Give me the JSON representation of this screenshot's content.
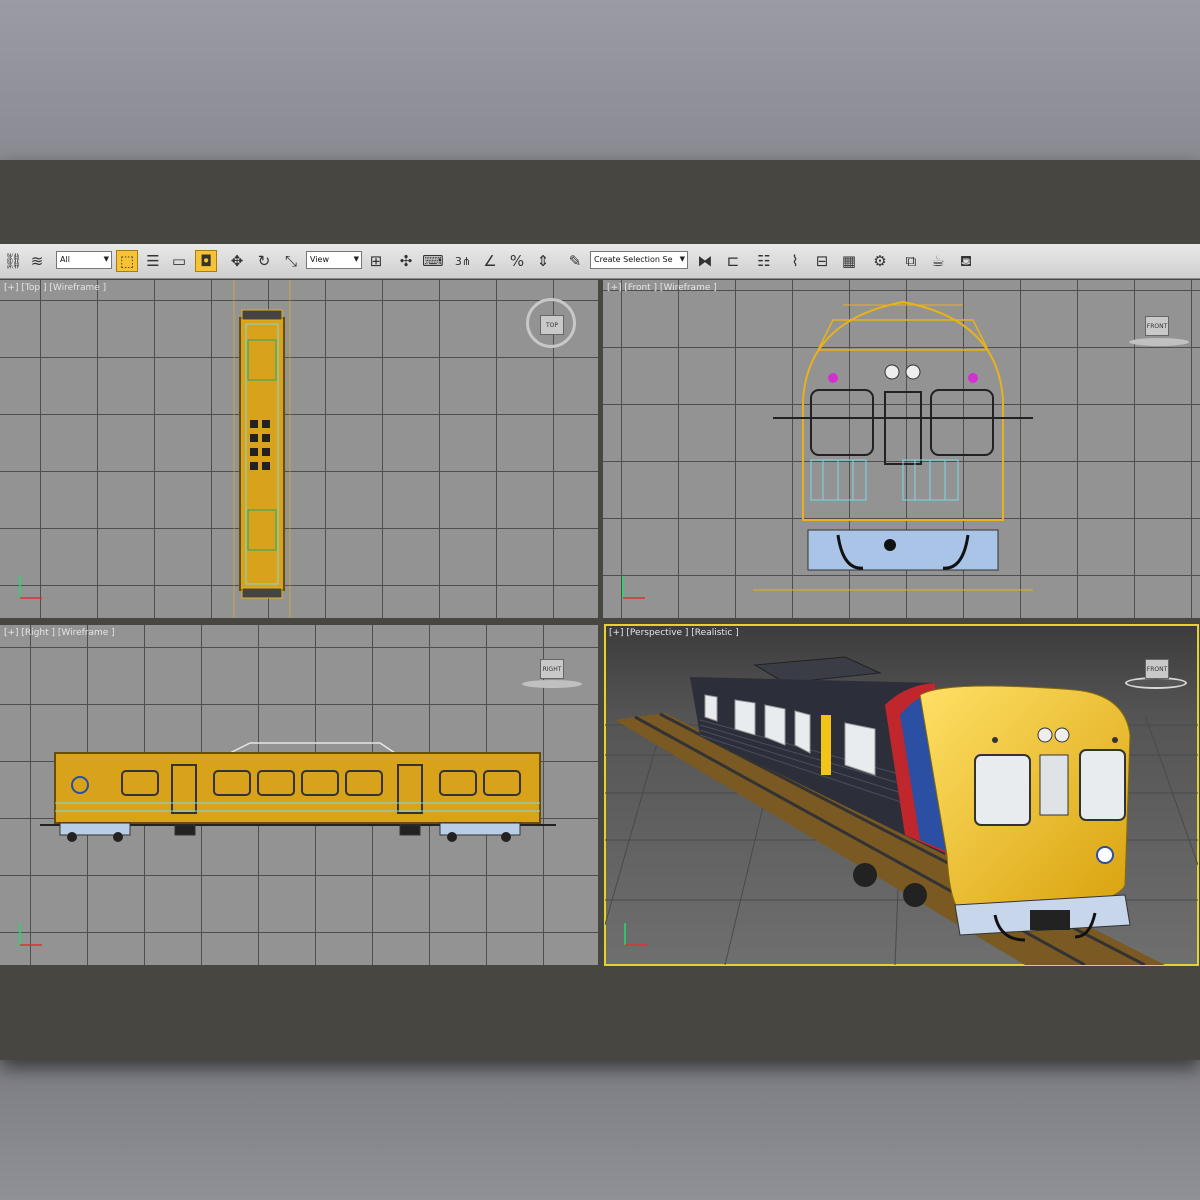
{
  "toolbar": {
    "selection_filter": "All",
    "reference_coord": "View",
    "selection_set": "Create Selection Se",
    "snap_label": "3",
    "icons": [
      "link-icon",
      "unlink-icon",
      "select-icon",
      "select-by-name-icon",
      "rect-select-icon",
      "window-crossing-icon",
      "move-icon",
      "rotate-icon",
      "scale-icon",
      "pivot-icon",
      "manipulate-icon",
      "keyboard-shortcut-icon",
      "snaps-icon",
      "angle-snap-icon",
      "percent-snap-icon",
      "spinner-snap-icon",
      "edit-named-sets-icon",
      "mirror-icon",
      "align-icon",
      "layer-icon",
      "curve-editor-icon",
      "schematic-icon",
      "material-editor-icon",
      "render-setup-icon",
      "render-frame-icon",
      "render-icon",
      "teapot-icon"
    ]
  },
  "viewports": {
    "top": {
      "label": "[+] [Top ] [Wireframe ]",
      "navcube": "TOP"
    },
    "front": {
      "label": "[+] [Front ] [Wireframe ]",
      "navcube": "FRONT"
    },
    "right": {
      "label": "[+] [Right ] [Wireframe ]",
      "navcube": "RIGHT"
    },
    "perspective": {
      "label": "[+] [Perspective ] [Realistic ]",
      "navcube": "FRONT"
    }
  },
  "colors": {
    "wire_yellow": "#e8b21c",
    "wire_cyan": "#7ad9e6",
    "train_yellow": "#f2c418",
    "train_dark": "#2c2f3a",
    "stripe_red": "#c0272d",
    "stripe_blue": "#2a4fa3",
    "active_border": "#e5d22c"
  }
}
